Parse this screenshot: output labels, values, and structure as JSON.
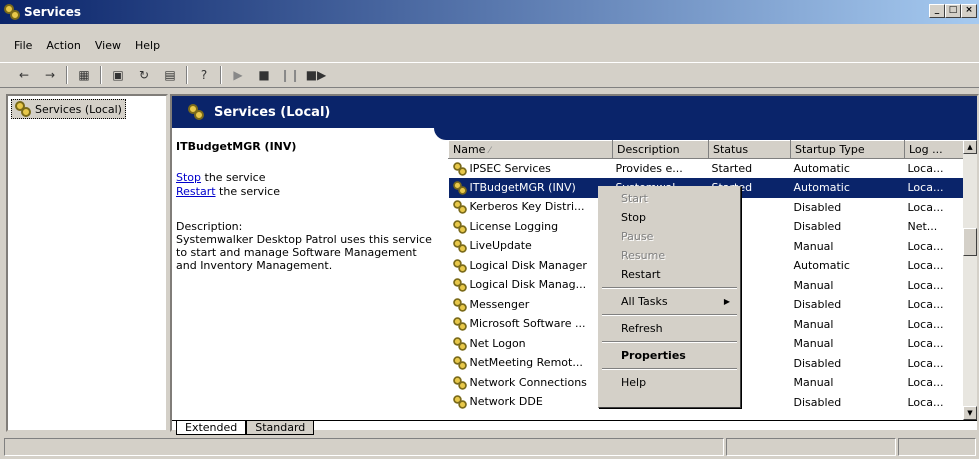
{
  "window": {
    "title": "Services",
    "controls": [
      "_",
      "□",
      "×"
    ]
  },
  "menu": [
    "File",
    "Action",
    "View",
    "Help"
  ],
  "toolbar": {
    "icons": [
      "back-icon",
      "forward-icon",
      "show-hide-tree-icon",
      "properties-icon",
      "refresh-icon",
      "export-list-icon",
      "help-icon",
      "play-icon",
      "stop-icon",
      "pause-icon",
      "restart-icon"
    ]
  },
  "tree": {
    "root": "Services (Local)"
  },
  "banner": {
    "title": "Services (Local)"
  },
  "detail": {
    "service_name": "ITBudgetMGR (INV)",
    "stop_link": "Stop",
    "stop_rest": " the service",
    "restart_link": "Restart",
    "restart_rest": " the service",
    "desc_label": "Description:",
    "desc_text": "Systemwalker Desktop Patrol uses this service to start and manage Software Management and Inventory Management."
  },
  "columns": [
    "Name",
    "Description",
    "Status",
    "Startup Type",
    "Log ..."
  ],
  "rows": [
    {
      "name": "IPSEC Services",
      "desc": "Provides e...",
      "status": "Started",
      "startup": "Automatic",
      "log": "Loca..."
    },
    {
      "name": "ITBudgetMGR (INV)",
      "desc": "Systemwal...",
      "status": "Started",
      "startup": "Automatic",
      "log": "Loca...",
      "selected": true
    },
    {
      "name": "Kerberos Key Distri...",
      "desc": "",
      "status": "",
      "startup": "Disabled",
      "log": "Loca..."
    },
    {
      "name": "License Logging",
      "desc": "",
      "status": "",
      "startup": "Disabled",
      "log": "Net..."
    },
    {
      "name": "LiveUpdate",
      "desc": "",
      "status": "",
      "startup": "Manual",
      "log": "Loca..."
    },
    {
      "name": "Logical Disk Manager",
      "desc": "",
      "status": "rted",
      "startup": "Automatic",
      "log": "Loca..."
    },
    {
      "name": "Logical Disk Manag...",
      "desc": "",
      "status": "",
      "startup": "Manual",
      "log": "Loca..."
    },
    {
      "name": "Messenger",
      "desc": "",
      "status": "",
      "startup": "Disabled",
      "log": "Loca..."
    },
    {
      "name": "Microsoft Software ...",
      "desc": "",
      "status": "",
      "startup": "Manual",
      "log": "Loca..."
    },
    {
      "name": "Net Logon",
      "desc": "",
      "status": "",
      "startup": "Manual",
      "log": "Loca..."
    },
    {
      "name": "NetMeeting Remot...",
      "desc": "",
      "status": "",
      "startup": "Disabled",
      "log": "Loca..."
    },
    {
      "name": "Network Connections",
      "desc": "",
      "status": "rted",
      "startup": "Manual",
      "log": "Loca..."
    },
    {
      "name": "Network DDE",
      "desc": "",
      "status": "",
      "startup": "Disabled",
      "log": "Loca..."
    }
  ],
  "context_menu": [
    {
      "label": "Start",
      "state": "disabled"
    },
    {
      "label": "Stop",
      "state": "normal"
    },
    {
      "label": "Pause",
      "state": "disabled"
    },
    {
      "label": "Resume",
      "state": "disabled"
    },
    {
      "label": "Restart",
      "state": "normal"
    },
    {
      "sep": true
    },
    {
      "label": "All Tasks",
      "state": "normal",
      "submenu": true
    },
    {
      "sep": true
    },
    {
      "label": "Refresh",
      "state": "normal"
    },
    {
      "sep": true
    },
    {
      "label": "Properties",
      "state": "bold"
    },
    {
      "sep": true
    },
    {
      "label": "Help",
      "state": "normal"
    }
  ],
  "tabs": [
    "Extended",
    "Standard"
  ],
  "colors": {
    "title_dark": "#0a246a",
    "title_light": "#a6caf0",
    "face": "#d4d0c8",
    "selection": "#0a246a",
    "link": "#0000cc"
  }
}
